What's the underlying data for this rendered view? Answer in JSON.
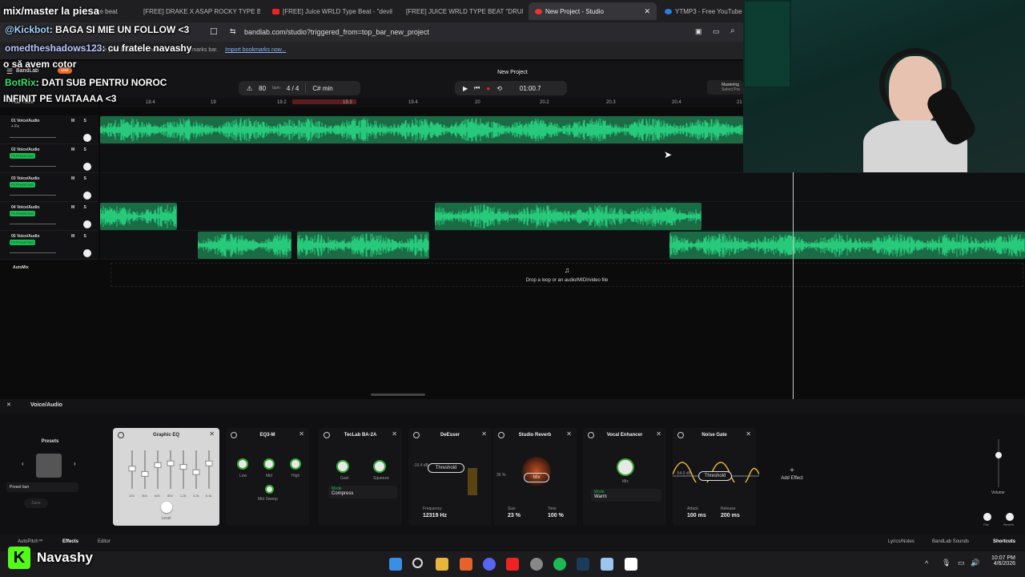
{
  "overlay": {
    "title": "mix/master la piesa",
    "chat1_user": "@Kickbot",
    "chat1_text": ": BAGA SI MIE UN FOLLOW <3",
    "chat2_user": "omedtheshadows123",
    "chat2_text": ": cu fratele navashy",
    "chat3": "o să avem cotor",
    "chat4_user": "BotRix",
    "chat4_text": ": DATI SUB PENTRU NOROC",
    "chat5": "INFINIT PE VIATAAAA <3",
    "streamer": "Navashy"
  },
  "browser": {
    "tabs": [
      {
        "label": "pe beat"
      },
      {
        "label": "[FREE] DRAKE X ASAP ROCKY TYPE B"
      },
      {
        "label": "[FREE] Juice WRLD Type Beat - \"devil"
      },
      {
        "label": "[FREE] JUICE WRLD TYPE BEAT \"DRUM"
      },
      {
        "label": "New Project - Studio"
      },
      {
        "label": "YTMP3 - Free YouTube"
      }
    ],
    "url": "bandlab.com/studio?triggered_from=top_bar_new_project",
    "bookmark_hint": "For quick access, place your bookmarks here on the bookmarks bar.",
    "import_bookmarks": "Import bookmarks now..."
  },
  "app": {
    "brand": "BandLab",
    "get_label": "Get",
    "project_title": "New Project",
    "tempo": "80",
    "tempo_unit": "bpm",
    "time_sig": "4 / 4",
    "key": "C# min",
    "time": "01:00.7",
    "mastering": "Mastering",
    "mastering_sub": "Select Pre",
    "add_track": "Add Track",
    "drop_hint": "Drop a loop or an audio/MIDI/video file",
    "automix": "AutoMix",
    "ruler_ticks": [
      "18.4",
      "19",
      "19.2",
      "19.3",
      "19.4",
      "20",
      "20.2",
      "20.3",
      "20.4",
      "21"
    ]
  },
  "tracks": [
    {
      "name": "01 Voice/Audio",
      "fx": "+ Fx"
    },
    {
      "name": "02 Voice/Audio",
      "fx": "Fx Preset bun"
    },
    {
      "name": "03 Voice/Audio",
      "fx": "Fx Preset bun"
    },
    {
      "name": "04 Voice/Audio",
      "fx": "Fx Preset bun"
    },
    {
      "name": "05 Voice/Audio",
      "fx": "Fx Preset bun"
    }
  ],
  "track_ms": "M S",
  "fx_panel": {
    "track_label": "Voice/Audio",
    "presets": "Presets",
    "preset_value": "Preset bun",
    "save": "Save",
    "add_effect": "Add Effect",
    "volume": "Volume",
    "pan": "Pan",
    "reverb": "Reverb",
    "cards": {
      "eq": {
        "title": "Graphic EQ",
        "level": "Level",
        "freqs": [
          "100",
          "300",
          "600",
          "800",
          "1.2k",
          "3.2k",
          "6.4k"
        ]
      },
      "eq3": {
        "title": "EQ3-M",
        "low": "Low",
        "mid": "Mid",
        "high": "High",
        "mid_sweep": "Mid Sweep"
      },
      "ba2a": {
        "title": "TecLab BA-2A",
        "gain": "Gain",
        "squeeze": "Squeeze",
        "mode_label": "Mode",
        "mode": "Compress"
      },
      "deesser": {
        "title": "DeEsser",
        "threshold": "Threshold",
        "db": "-16.4 dB",
        "freq_label": "Frequency",
        "freq": "12319 Hz"
      },
      "reverb": {
        "title": "Studio Reverb",
        "mix": "Mix",
        "pct": "36 %",
        "size_label": "Size",
        "size": "23 %",
        "tone_label": "Tone",
        "tone": "100 %"
      },
      "enhancer": {
        "title": "Vocal Enhancer",
        "mix": "Mix",
        "mode_label": "Mode",
        "mode": "Warm"
      },
      "gate": {
        "title": "Noise Gate",
        "threshold": "Threshold",
        "db": "-54.0 dB",
        "attack_label": "Attack",
        "attack": "100 ms",
        "release_label": "Release",
        "release": "200 ms"
      }
    }
  },
  "bottom_tabs": {
    "autopitch": "AutoPitch™",
    "effects": "Effects",
    "editor": "Editor",
    "lyrics": "Lyrics/Notes",
    "sounds": "BandLab Sounds",
    "shortcuts": "Shortcuts"
  },
  "taskbar": {
    "time": "10:07 PM",
    "date": "4/6/2026"
  },
  "colors": {
    "wave": "#27c97a",
    "clip_bg": "#1b6b45",
    "accent": "#1db954"
  }
}
